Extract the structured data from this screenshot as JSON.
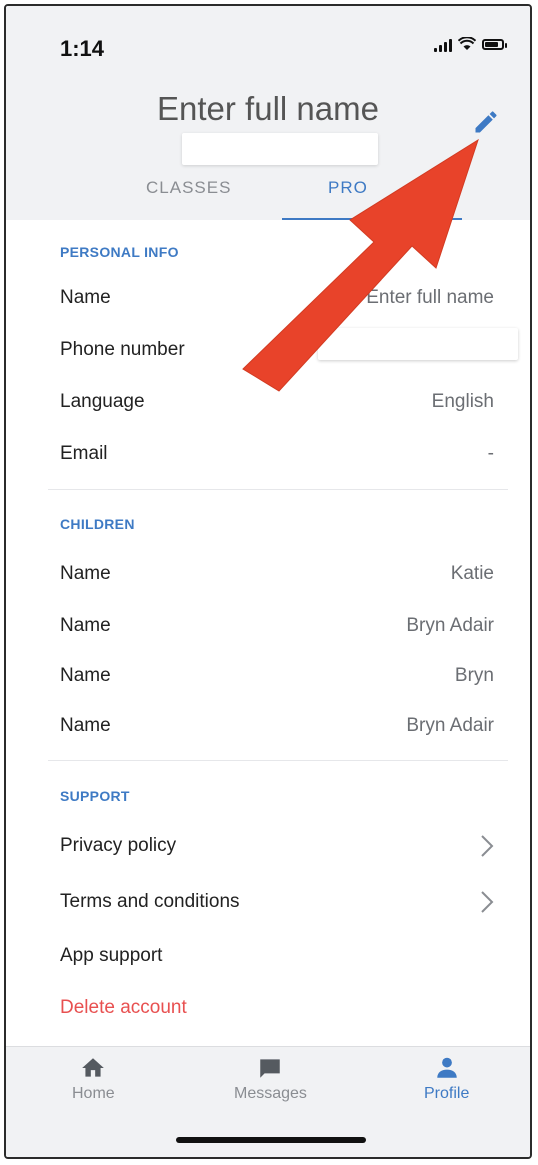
{
  "status_bar": {
    "time": "1:14"
  },
  "header": {
    "title": "Enter full name",
    "tabs": [
      {
        "label": "CLASSES",
        "active": false
      },
      {
        "label": "PRO",
        "active": true
      }
    ]
  },
  "personal_info": {
    "title": "PERSONAL INFO",
    "rows": [
      {
        "label": "Name",
        "value": "Enter full name"
      },
      {
        "label": "Phone number",
        "value": ""
      },
      {
        "label": "Language",
        "value": "English"
      },
      {
        "label": "Email",
        "value": "-"
      }
    ]
  },
  "children": {
    "title": "CHILDREN",
    "rows": [
      {
        "label": "Name",
        "value": "Katie"
      },
      {
        "label": "Name",
        "value": "Bryn Adair"
      },
      {
        "label": "Name",
        "value": "Bryn"
      },
      {
        "label": "Name",
        "value": "Bryn Adair"
      }
    ]
  },
  "support": {
    "title": "SUPPORT",
    "items": [
      {
        "label": "Privacy policy"
      },
      {
        "label": "Terms and conditions"
      },
      {
        "label": "App support"
      },
      {
        "label": "Delete account"
      }
    ]
  },
  "tabbar": {
    "items": [
      {
        "label": "Home",
        "icon": "home-icon"
      },
      {
        "label": "Messages",
        "icon": "message-icon"
      },
      {
        "label": "Profile",
        "icon": "person-icon",
        "active": true
      }
    ]
  },
  "colors": {
    "accent": "#3e7ac4",
    "danger": "#e85050",
    "annotation": "#e8432a"
  }
}
